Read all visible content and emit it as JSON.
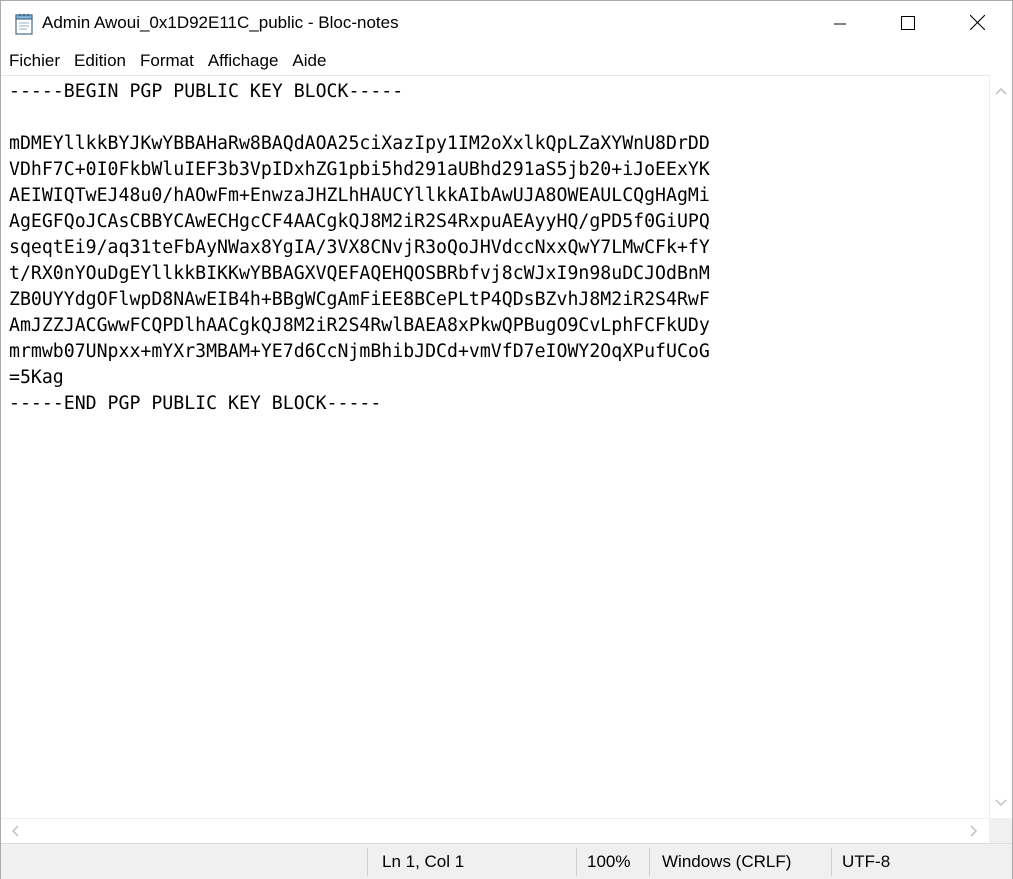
{
  "window": {
    "title": "Admin Awoui_0x1D92E11C_public - Bloc-notes",
    "app_icon": "notepad-icon",
    "controls": {
      "minimize": "minimize-icon",
      "maximize": "maximize-icon",
      "close": "close-icon"
    }
  },
  "menu": {
    "items": [
      {
        "label": "Fichier"
      },
      {
        "label": "Edition"
      },
      {
        "label": "Format"
      },
      {
        "label": "Affichage"
      },
      {
        "label": "Aide"
      }
    ]
  },
  "editor": {
    "lines": [
      "-----BEGIN PGP PUBLIC KEY BLOCK-----",
      "",
      "mDMEYllkkBYJKwYBBAHaRw8BAQdAOA25ciXazIpy1IM2oXxlkQpLZaXYWnU8DrDD",
      "VDhF7C+0I0FkbWluIEF3b3VpIDxhZG1pbi5hd291aUBhd291aS5jb20+iJoEExYK",
      "AEIWIQTwEJ48u0/hAOwFm+EnwzaJHZLhHAUCYllkkAIbAwUJA8OWEAULCQgHAgMi",
      "AgEGFQoJCAsCBBYCAwECHgcCF4AACgkQJ8M2iR2S4RxpuAEAyyHQ/gPD5f0GiUPQ",
      "sqeqtEi9/aq31teFbAyNWax8YgIA/3VX8CNvjR3oQoJHVdccNxxQwY7LMwCFk+fY",
      "t/RX0nYOuDgEYllkkBIKKwYBBAGXVQEFAQEHQOSBRbfvj8cWJxI9n98uDCJOdBnM",
      "ZB0UYYdgOFlwpD8NAwEIB4h+BBgWCgAmFiEE8BCePLtP4QDsBZvhJ8M2iR2S4RwF",
      "AmJZZJACGwwFCQPDlhAACgkQJ8M2iR2S4RwlBAEA8xPkwQPBugO9CvLphFCFkUDy",
      "mrmwb07UNpxx+mYXr3MBAM+YE7d6CcNjmBhibJDCd+vmVfD7eIOWY2OqXPufUCoG",
      "=5Kag",
      "-----END PGP PUBLIC KEY BLOCK-----"
    ]
  },
  "scrollbars": {
    "up": "scroll-up-arrow-icon",
    "down": "scroll-down-arrow-icon",
    "left": "scroll-left-arrow-icon",
    "right": "scroll-right-arrow-icon"
  },
  "status": {
    "position": "Ln 1, Col 1",
    "zoom": "100%",
    "line_ending": "Windows (CRLF)",
    "encoding": "UTF-8"
  }
}
